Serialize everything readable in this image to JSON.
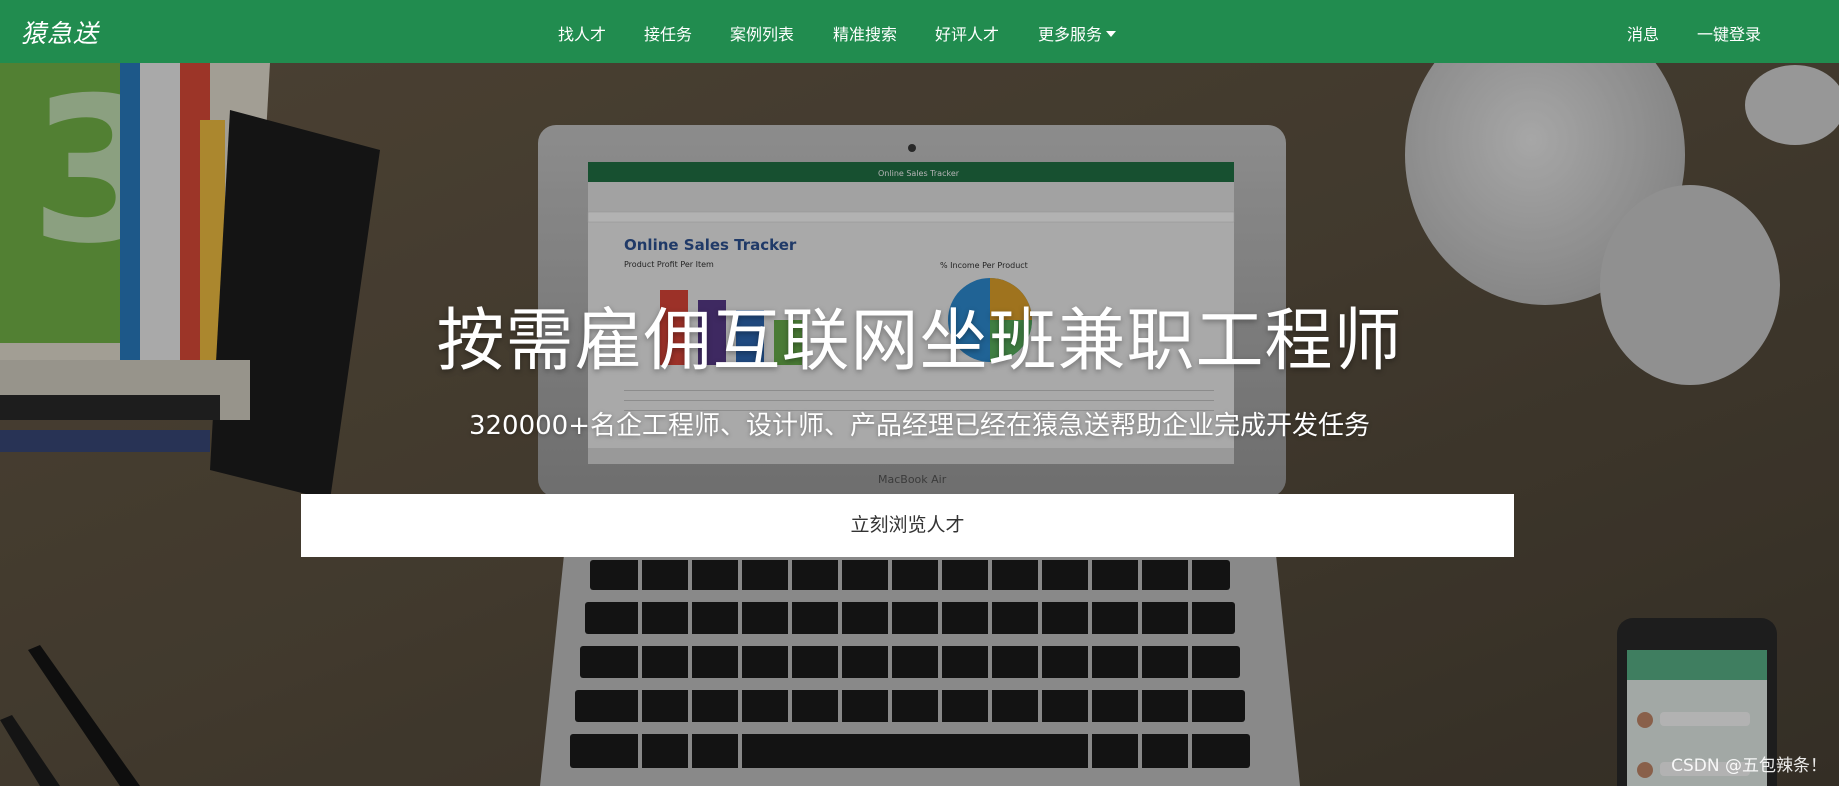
{
  "navbar": {
    "brand": "猿急送",
    "links": [
      "找人才",
      "接任务",
      "案例列表",
      "精准搜索",
      "好评人才",
      "更多服务"
    ],
    "right_links": [
      "消息",
      "一键登录"
    ],
    "background_color": "#218c4f"
  },
  "hero": {
    "title": "按需雇佣互联网坐班兼职工程师",
    "subtitle": "320000+名企工程师、设计师、产品经理已经在猿急送帮助企业完成开发任务",
    "cta_label": "立刻浏览人才",
    "background": "desk photo with laptop showing spreadsheet, books, phone"
  },
  "laptop_screen": {
    "app_title": "Online Sales Tracker",
    "sheet_title": "Online Sales Tracker",
    "chart1_title": "Product Profit Per Item",
    "chart2_title": "% Income Per Product",
    "laptop_model": "MacBook Air"
  },
  "watermark": "CSDN @五包辣条！"
}
